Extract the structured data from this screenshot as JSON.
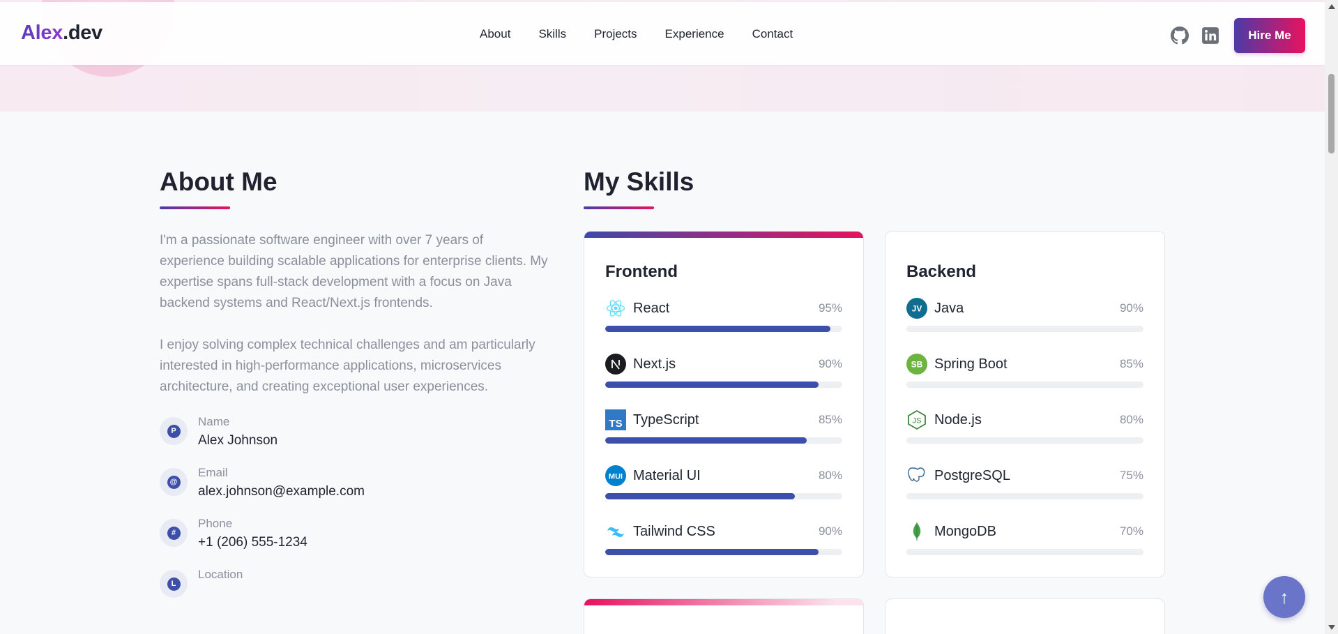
{
  "header": {
    "logo_part1": "Alex",
    "logo_part2": ".dev",
    "nav": [
      "About",
      "Skills",
      "Projects",
      "Experience",
      "Contact"
    ],
    "social_icons": [
      "github-icon",
      "linkedin-icon"
    ],
    "cta_label": "Hire Me"
  },
  "about": {
    "title": "About Me",
    "paragraphs": [
      "I'm a passionate software engineer with over 7 years of experience building scalable applications for enterprise clients. My expertise spans full-stack development with a focus on Java backend systems and React/Next.js frontends.",
      "I enjoy solving complex technical challenges and am particularly interested in high-performance applications, microservices architecture, and creating exceptional user experiences."
    ],
    "info": [
      {
        "icon_letter": "P",
        "label": "Name",
        "value": "Alex Johnson"
      },
      {
        "icon_letter": "@",
        "label": "Email",
        "value": "alex.johnson@example.com"
      },
      {
        "icon_letter": "#",
        "label": "Phone",
        "value": "+1 (206) 555-1234"
      },
      {
        "icon_letter": "L",
        "label": "Location",
        "value": ""
      }
    ]
  },
  "skills": {
    "title": "My Skills",
    "categories": [
      {
        "title": "Frontend",
        "items": [
          {
            "name": "React",
            "percent_label": "95%",
            "level": 95,
            "icon": "react-icon"
          },
          {
            "name": "Next.js",
            "percent_label": "90%",
            "level": 90,
            "icon": "nextjs-icon"
          },
          {
            "name": "TypeScript",
            "percent_label": "85%",
            "level": 85,
            "icon": "typescript-icon"
          },
          {
            "name": "Material UI",
            "percent_label": "80%",
            "level": 80,
            "icon": "material-ui-icon"
          },
          {
            "name": "Tailwind CSS",
            "percent_label": "90%",
            "level": 90,
            "icon": "tailwind-icon"
          }
        ]
      },
      {
        "title": "Backend",
        "items": [
          {
            "name": "Java",
            "percent_label": "90%",
            "level": 0,
            "icon": "java-icon"
          },
          {
            "name": "Spring Boot",
            "percent_label": "85%",
            "level": 0,
            "icon": "spring-boot-icon"
          },
          {
            "name": "Node.js",
            "percent_label": "80%",
            "level": 0,
            "icon": "nodejs-icon"
          },
          {
            "name": "PostgreSQL",
            "percent_label": "75%",
            "level": 0,
            "icon": "postgresql-icon"
          },
          {
            "name": "MongoDB",
            "percent_label": "70%",
            "level": 0,
            "icon": "mongodb-icon"
          }
        ]
      }
    ]
  },
  "scroll_top_label": "↑",
  "colors": {
    "accent_start": "#4b3aa8",
    "accent_end": "#e8125e",
    "bar_fill": "#3e4fa9",
    "muted_text": "#8a8f9c"
  }
}
